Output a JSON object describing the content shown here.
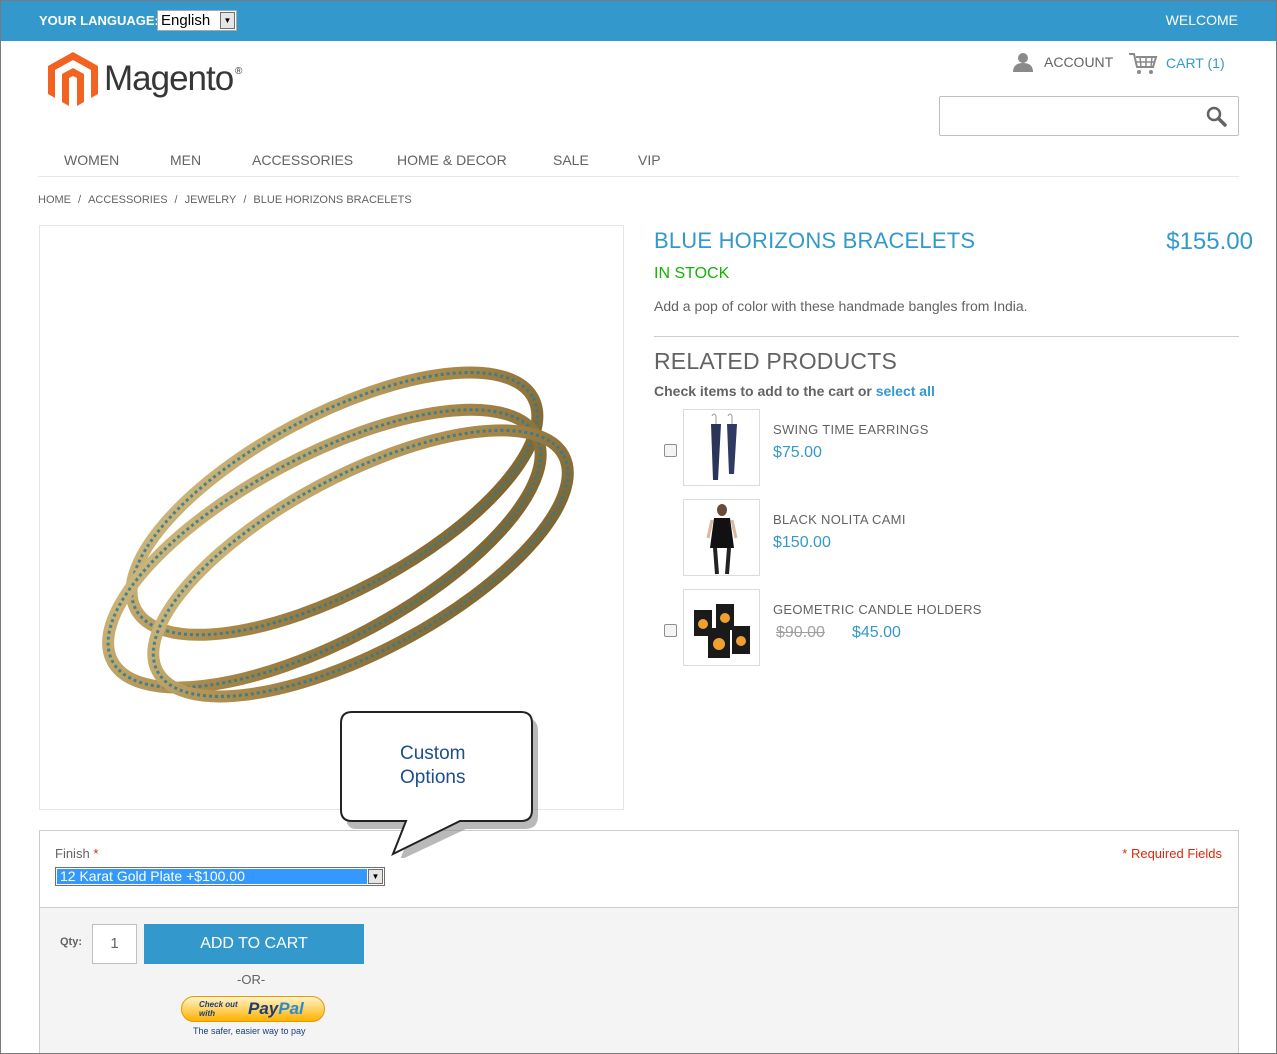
{
  "topbar": {
    "language_label": "YOUR LANGUAGE:",
    "language_value": "English",
    "welcome": "WELCOME"
  },
  "header": {
    "logo_text": "Magento",
    "logo_reg": "®",
    "account": "ACCOUNT",
    "cart": "CART (1)",
    "search_placeholder": ""
  },
  "nav": {
    "items": [
      "WOMEN",
      "MEN",
      "ACCESSORIES",
      "HOME & DECOR",
      "SALE",
      "VIP"
    ]
  },
  "breadcrumb": {
    "items": [
      "HOME",
      "ACCESSORIES",
      "JEWELRY",
      "BLUE HORIZONS BRACELETS"
    ],
    "separator": "/"
  },
  "product": {
    "name": "BLUE HORIZONS BRACELETS",
    "price": "$155.00",
    "stock": "IN STOCK",
    "description": "Add a pop of color with these handmade bangles from India."
  },
  "related": {
    "title": "RELATED PRODUCTS",
    "check_text": "Check items to add to the cart or",
    "select_all": "select all",
    "items": [
      {
        "name": "SWING TIME EARRINGS",
        "price": "$75.00"
      },
      {
        "name": "BLACK NOLITA CAMI",
        "price": "$150.00"
      },
      {
        "name": "GEOMETRIC CANDLE HOLDERS",
        "old_price": "$90.00",
        "special_price": "$45.00"
      }
    ]
  },
  "options": {
    "finish_label": "Finish",
    "required_mark": "*",
    "finish_value": "12 Karat Gold Plate +$100.00",
    "required_fields": "* Required Fields"
  },
  "cart_form": {
    "qty_label": "Qty:",
    "qty_value": "1",
    "add_to_cart": "ADD TO CART",
    "or": "-OR-",
    "paypal_checkout": "Check out with",
    "paypal_pay": "Pay",
    "paypal_pal": "Pal",
    "paypal_tagline": "The safer, easier way to pay"
  },
  "callout": {
    "line1": "Custom",
    "line2": "Options"
  },
  "colors": {
    "accent": "#3399cc",
    "in_stock": "#11b400",
    "required": "#df280a"
  }
}
